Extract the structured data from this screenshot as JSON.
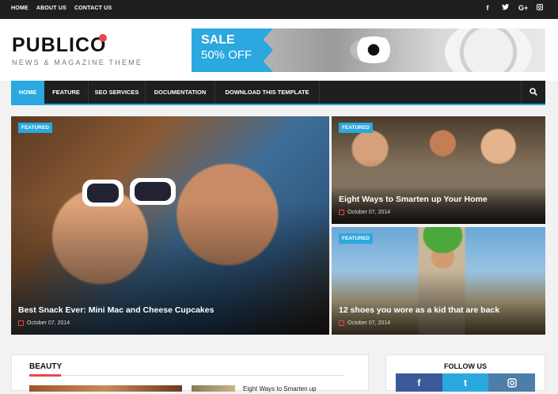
{
  "topbar": {
    "links": [
      "HOME",
      "ABOUT US",
      "CONTACT US"
    ],
    "social_icons": [
      "f",
      "t",
      "G+",
      "ig"
    ]
  },
  "logo": {
    "name": "PUBLICO",
    "tagline": "NEWS & MAGAZINE THEME"
  },
  "banner": {
    "sale_line1": "SALE",
    "sale_line2": "50% OFF"
  },
  "nav": {
    "items": [
      "HOME",
      "FEATURE",
      "SEO SERVICES",
      "DOCUMENTATION",
      "DOWNLOAD THIS TEMPLATE"
    ],
    "active": "HOME"
  },
  "featured": [
    {
      "badge": "FEATURED",
      "title": "Best Snack Ever: Mini Mac and Cheese Cupcakes",
      "date": "October 07, 2014"
    },
    {
      "badge": "FEATURED",
      "title": "Eight Ways to Smarten up Your Home",
      "date": "October 07, 2014"
    },
    {
      "badge": "FEATURED",
      "title": "12 shoes you wore as a kid that are back",
      "date": "October 07, 2014"
    }
  ],
  "sections": {
    "beauty_title": "BEAUTY",
    "beauty_post": "Eight Ways to Smarten up",
    "follow_title": "FOLLOW US"
  },
  "colors": {
    "accent": "#2aa8df",
    "red": "#e8474b",
    "dark": "#1f1f1f"
  }
}
